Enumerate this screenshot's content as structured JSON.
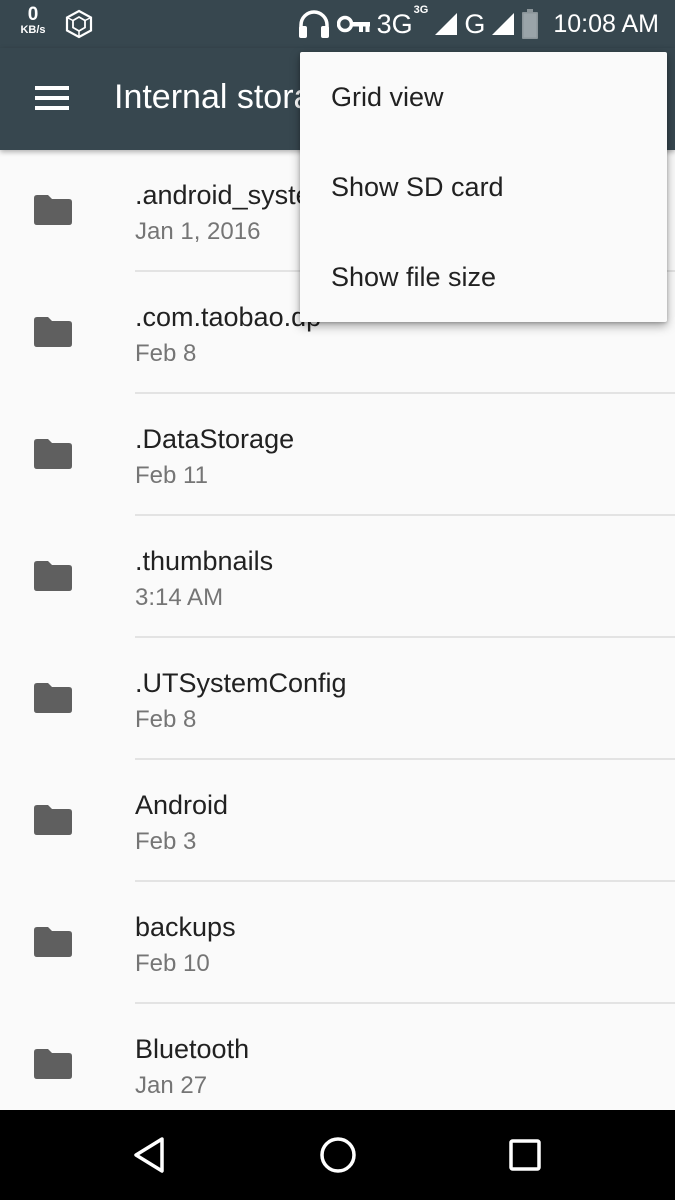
{
  "status_bar": {
    "net_speed_value": "0",
    "net_speed_unit": "KB/s",
    "network_3g": "3G",
    "network_3g_sup": "3G",
    "network_g": "G",
    "time": "10:08 AM",
    "icons": [
      "headset-icon",
      "vpn-key-icon",
      "signal-icon",
      "battery-icon",
      "cube-icon"
    ]
  },
  "toolbar": {
    "title": "Internal storage",
    "menu_icon": "hamburger-menu-icon"
  },
  "popup_menu": {
    "items": [
      {
        "label": "Grid view"
      },
      {
        "label": "Show SD card"
      },
      {
        "label": "Show file size"
      }
    ]
  },
  "files": [
    {
      "name": ".android_system",
      "date": "Jan 1, 2016"
    },
    {
      "name": ".com.taobao.dp",
      "date": "Feb 8"
    },
    {
      "name": ".DataStorage",
      "date": "Feb 11"
    },
    {
      "name": ".thumbnails",
      "date": "3:14 AM"
    },
    {
      "name": ".UTSystemConfig",
      "date": "Feb 8"
    },
    {
      "name": "Android",
      "date": "Feb 3"
    },
    {
      "name": "backups",
      "date": "Feb 10"
    },
    {
      "name": "Bluetooth",
      "date": "Jan 27"
    }
  ],
  "colors": {
    "toolbar": "#37474f",
    "folder_icon": "#5f5f5f",
    "background": "#fafafa"
  }
}
